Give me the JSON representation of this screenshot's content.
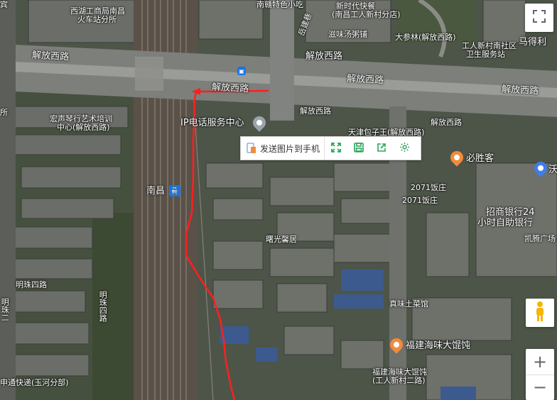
{
  "colors": {
    "route": "#ff1f1f",
    "poi_orange": "#f28b3a",
    "poi_blue": "#3f7ee8",
    "poi_gray": "#9aa4ad",
    "toolbar_green": "#2aa55b"
  },
  "labels": {
    "xihu_gongshang": "西湖工商局南昌",
    "xihu_gongshang2": "火车站分所",
    "jiefang_xilu_1": "解放西路",
    "jiefang_xilu_2": "解放西路",
    "jiefang_xilu_3": "解放西路",
    "jiefang_xilu_4": "解放西路",
    "jiefang_xilu_5": "解放西路",
    "jiefang_xilu_6": "解放西路",
    "jiefang_xilu_7": "解放西路",
    "top_snack": "南赣特色小吃",
    "xinxin_kuaican": "新时代快餐",
    "xinxin_branch": "(南昌工人新村分店)",
    "zimian": "滋味汤粥铺",
    "dashencai": "大参林(解放西路)",
    "gongren_xincun": "工人新村南社区",
    "weisheng": "卫生服务站",
    "madeli": "马得利",
    "yanwei_road": "岳建巷",
    "hongsheng_1": "宏声琴行艺术培训",
    "hongsheng_2": "中心(解放西路)",
    "ip_service": "IP电话服务中心",
    "tianjin_baozi": "天津包子王(解放西路)",
    "shenshengke": "必胜客",
    "wo": "沃",
    "fandian_2071_a": "2071饭庄",
    "fandian_2071_b": "2071饭庄",
    "zhaoshang_1": "招商银行24",
    "zhaoshang_2": "小时自助银行",
    "kaiteng": "凯腾广场",
    "nanchang_station": "南昌",
    "shuguang": "曙光馨居",
    "mingzhu_silu_1": "明珠四路",
    "mingzhu_silu_2": "明珠四路",
    "mingzhu_left": "明珠二",
    "zhenwei": "真味土菜馆",
    "fujian_haiwei": "福建海味大馄饨",
    "fujian_branch_1": "福建海味大馄饨",
    "fujian_branch_2": "(工人新村二路)",
    "kuaidi": "申通快递(玉河分部)",
    "left_edge": "所",
    "top_left_edge": "宾"
  },
  "toolbar": {
    "send_label": "发送图片到手机",
    "icons": [
      "fullscreen-icon",
      "save-icon",
      "share-icon",
      "settings-icon"
    ]
  },
  "controls": {
    "zoom_in": "+",
    "zoom_out": "−"
  }
}
